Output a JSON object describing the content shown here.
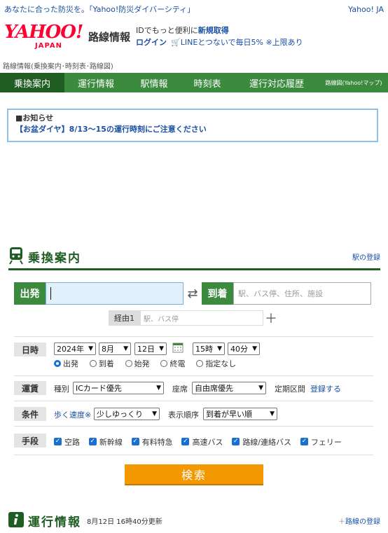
{
  "topbar": {
    "promo": "あなたに合った防災を。「Yahoo!防災ダイバーシティ」",
    "yahoo_link": "Yahoo! JA"
  },
  "header": {
    "logo_main": "YAHOO!",
    "logo_sub": "JAPAN",
    "service": "路線情報",
    "id_text": "IDでもっと便利に",
    "id_link": "新規取得",
    "login": "ログイン",
    "line_promo": "LINEとつないで毎日5% ※上限あり"
  },
  "breadcrumb": "路線情報(乗換案内･時刻表･路線図)",
  "nav": {
    "tabs": [
      "乗換案内",
      "運行情報",
      "駅情報",
      "時刻表",
      "運行対応履歴"
    ],
    "map_link": "路線図(Yahoo!マップ)"
  },
  "notice": {
    "title": "■お知らせ",
    "link": "【お盆ダイヤ】8/13〜15の運行時刻にご注意ください"
  },
  "transfer": {
    "title": "乗換案内",
    "station_link": "駅の登録",
    "from_label": "出発",
    "from_value": "",
    "to_label": "到着",
    "to_placeholder": "駅、バス停、住所、施設",
    "via_label": "経由1",
    "via_placeholder": "駅、バス停",
    "datetime": {
      "label": "日時",
      "year": "2024年",
      "month": "8月",
      "day": "12日",
      "hour": "15時",
      "minute": "40分",
      "options": [
        "出発",
        "到着",
        "始発",
        "終電",
        "指定なし"
      ],
      "selected": "出発"
    },
    "fare": {
      "label": "運賃",
      "type_label": "種別",
      "type_value": "ICカード優先",
      "seat_label": "座席",
      "seat_value": "自由席優先",
      "pass_label": "定期区間",
      "pass_link": "登録する"
    },
    "condition": {
      "label": "条件",
      "speed_link": "歩く速度※",
      "speed_value": "少しゆっくり",
      "order_label": "表示順序",
      "order_value": "到着が早い順"
    },
    "means": {
      "label": "手段",
      "items": [
        "空路",
        "新幹線",
        "有料特急",
        "高速バス",
        "路線/連絡バス",
        "フェリー"
      ]
    },
    "search_button": "検索"
  },
  "unko": {
    "title": "運行情報",
    "updated": "8月12日 16時40分更新",
    "link": "路線の登録"
  },
  "colors": {
    "green": "#3b8a3e",
    "dark_green": "#1f5d22",
    "orange": "#f39800",
    "link": "#1a4fa3",
    "yahoo_red": "#ff0033"
  }
}
